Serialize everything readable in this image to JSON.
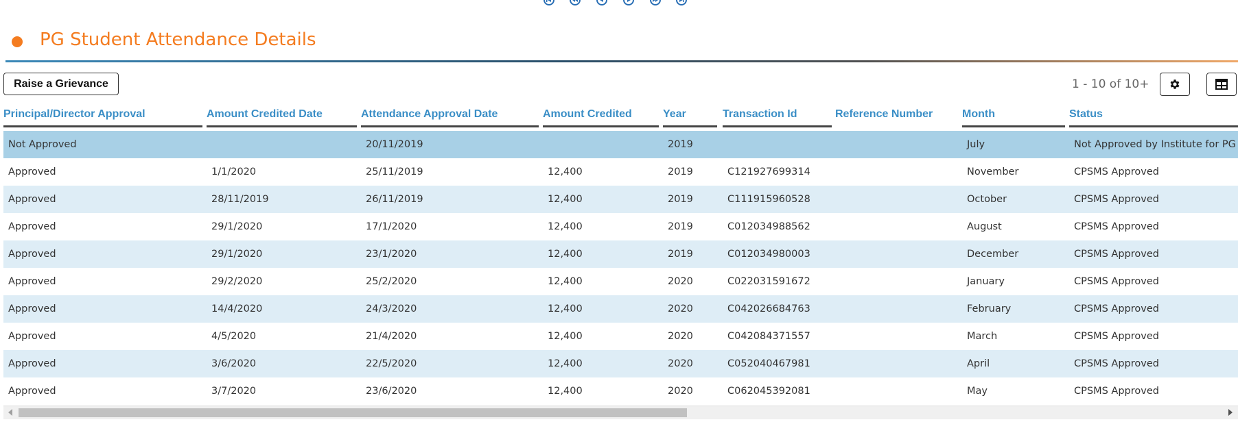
{
  "pager": {
    "icons": [
      "first-page-icon",
      "previous-block-icon",
      "previous-page-icon",
      "next-page-icon",
      "next-block-icon",
      "last-page-icon"
    ]
  },
  "page_title": "PG Student Attendance Details",
  "toolbar": {
    "grievance_label": "Raise a Grievance",
    "paging_info": "1 - 10 of 10+",
    "settings_icon": "gear-icon",
    "columns_icon": "table-columns-icon"
  },
  "table": {
    "columns": [
      "Principal/Director Approval",
      "Amount Credited Date",
      "Attendance Approval Date",
      "Amount Credited",
      "Year",
      "Transaction Id",
      "Reference Number",
      "Month",
      "Status"
    ],
    "rows": [
      [
        "Not Approved",
        "",
        "20/11/2019",
        "",
        "2019",
        "",
        "",
        "July",
        "Not Approved by Institute for PG"
      ],
      [
        "Approved",
        "1/1/2020",
        "25/11/2019",
        "12,400",
        "2019",
        "C121927699314",
        "",
        "November",
        "CPSMS Approved"
      ],
      [
        "Approved",
        "28/11/2019",
        "26/11/2019",
        "12,400",
        "2019",
        "C111915960528",
        "",
        "October",
        "CPSMS Approved"
      ],
      [
        "Approved",
        "29/1/2020",
        "17/1/2020",
        "12,400",
        "2019",
        "C012034988562",
        "",
        "August",
        "CPSMS Approved"
      ],
      [
        "Approved",
        "29/1/2020",
        "23/1/2020",
        "12,400",
        "2019",
        "C012034980003",
        "",
        "December",
        "CPSMS Approved"
      ],
      [
        "Approved",
        "29/2/2020",
        "25/2/2020",
        "12,400",
        "2020",
        "C022031591672",
        "",
        "January",
        "CPSMS Approved"
      ],
      [
        "Approved",
        "14/4/2020",
        "24/3/2020",
        "12,400",
        "2020",
        "C042026684763",
        "",
        "February",
        "CPSMS Approved"
      ],
      [
        "Approved",
        "4/5/2020",
        "21/4/2020",
        "12,400",
        "2020",
        "C042084371557",
        "",
        "March",
        "CPSMS Approved"
      ],
      [
        "Approved",
        "3/6/2020",
        "22/5/2020",
        "12,400",
        "2020",
        "C052040467981",
        "",
        "April",
        "CPSMS Approved"
      ],
      [
        "Approved",
        "3/7/2020",
        "23/6/2020",
        "12,400",
        "2020",
        "C062045392081",
        "",
        "May",
        "CPSMS Approved"
      ]
    ]
  },
  "colors": {
    "accent": "#f47c20",
    "header_text": "#3a8ec6",
    "row_alt": "#deedf6",
    "row_selected": "#a8d0e6"
  }
}
